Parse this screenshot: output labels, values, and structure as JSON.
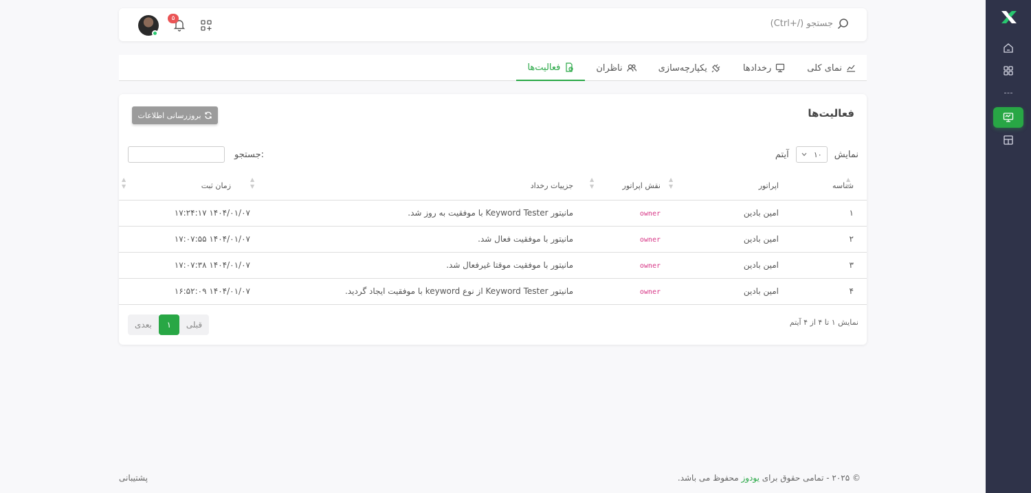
{
  "topbar": {
    "search_placeholder": "جستجو (/+Ctrl)",
    "notification_count": "۵"
  },
  "tabs": [
    {
      "label": "نمای کلی",
      "icon": "chart-icon"
    },
    {
      "label": "رخدادها",
      "icon": "monitor-icon"
    },
    {
      "label": "یکپارچه‌سازی",
      "icon": "plug-icon"
    },
    {
      "label": "ناظران",
      "icon": "users-icon"
    },
    {
      "label": "فعالیت‌ها",
      "icon": "activity-icon",
      "active": true
    }
  ],
  "card": {
    "title": "فعالیت‌ها",
    "refresh_label": "بروزرسانی اطلاعات",
    "show_label": "نمایش",
    "page_size": "۱۰",
    "items_label": "آیتم",
    "search_label": "جستجو:"
  },
  "table": {
    "headers": [
      "شناسه",
      "اپراتور",
      "نقش اپراتور",
      "جزییات رخداد",
      "زمان ثبت"
    ],
    "rows": [
      {
        "id": "۱",
        "operator": "امین بادین",
        "role": "owner",
        "detail": "مانیتور Keyword Tester با موفقیت به روز شد.",
        "time": "۱۴۰۴/۰۱/۰۷ ۱۷:۲۴:۱۷"
      },
      {
        "id": "۲",
        "operator": "امین بادین",
        "role": "owner",
        "detail": "مانیتور با موفقیت فعال شد.",
        "time": "۱۴۰۴/۰۱/۰۷ ۱۷:۰۷:۵۵"
      },
      {
        "id": "۳",
        "operator": "امین بادین",
        "role": "owner",
        "detail": "مانیتور با موفقیت موقتا غیرفعال شد.",
        "time": "۱۴۰۴/۰۱/۰۷ ۱۷:۰۷:۳۸"
      },
      {
        "id": "۴",
        "operator": "امین بادین",
        "role": "owner",
        "detail": "مانیتور Keyword Tester از نوع keyword با موفقیت ایجاد گردید.",
        "time": "۱۴۰۴/۰۱/۰۷ ۱۶:۵۲:۰۹"
      }
    ]
  },
  "pagination": {
    "info": "نمایش ۱ تا ۴ از ۴ آیتم",
    "prev": "قبلی",
    "current": "۱",
    "next": "بعدی"
  },
  "footer": {
    "copyright_prefix": "© ۲۰۲۵ - تمامی حقوق برای ",
    "brand": "یودوز",
    "copyright_suffix": " محفوظ می باشد.",
    "support": "پشتیبانی"
  },
  "colors": {
    "accent": "#28a745",
    "sidebar": "#2f3349",
    "badge": "#ea5455",
    "role": "#d63384"
  }
}
